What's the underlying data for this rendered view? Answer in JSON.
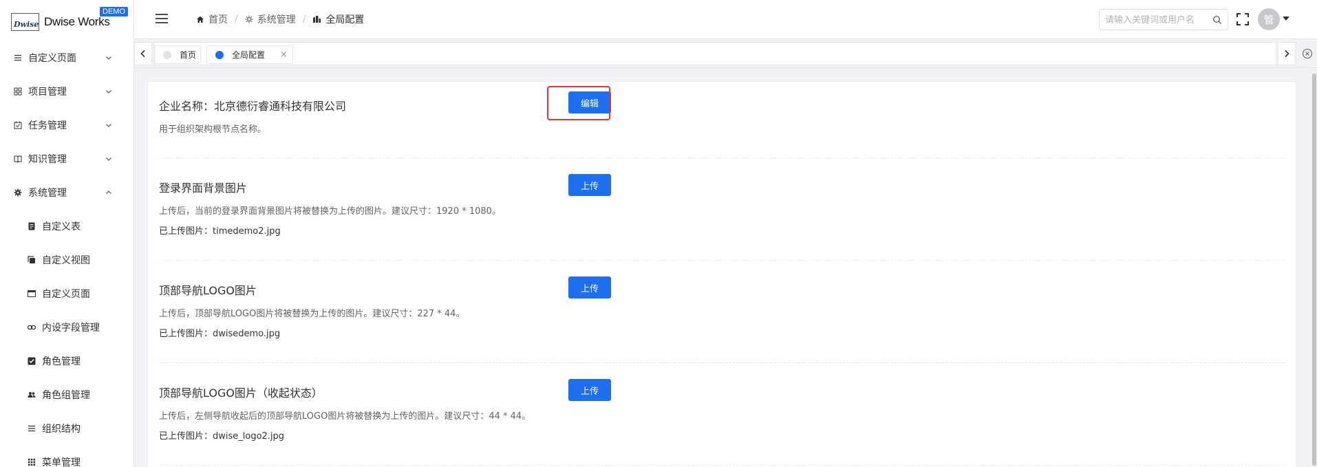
{
  "brand": {
    "logo_mark": "Dwise",
    "name": "Dwise Works",
    "badge": "DEMO",
    "accent": "#1e6ef0"
  },
  "sidebar": {
    "items": [
      {
        "label": "自定义页面",
        "icon": "list-icon"
      },
      {
        "label": "项目管理",
        "icon": "grid-icon"
      },
      {
        "label": "任务管理",
        "icon": "calendar-check-icon"
      },
      {
        "label": "知识管理",
        "icon": "book-icon"
      },
      {
        "label": "系统管理",
        "icon": "gear-icon",
        "expanded": true
      }
    ],
    "sub_items": [
      {
        "label": "自定义表",
        "icon": "document-icon"
      },
      {
        "label": "自定义视图",
        "icon": "copy-icon"
      },
      {
        "label": "自定义页面",
        "icon": "window-icon"
      },
      {
        "label": "内设字段管理",
        "icon": "link-icon"
      },
      {
        "label": "角色管理",
        "icon": "checkbox-icon"
      },
      {
        "label": "角色组管理",
        "icon": "group-icon"
      },
      {
        "label": "组织结构",
        "icon": "list-icon"
      },
      {
        "label": "菜单管理",
        "icon": "dots-grid-icon"
      }
    ]
  },
  "header": {
    "breadcrumb": [
      {
        "label": "首页",
        "icon": "home-icon"
      },
      {
        "label": "系统管理",
        "icon": "gear-icon"
      },
      {
        "label": "全局配置",
        "icon": "building-icon"
      }
    ],
    "search_placeholder": "请输入关键词或用户名",
    "avatar_text": "管"
  },
  "tabs": [
    {
      "label": "首页",
      "active": false,
      "dot_color": "#e4e4e4"
    },
    {
      "label": "全局配置",
      "active": true,
      "dot_color": "#1e6ef0",
      "close": "×"
    }
  ],
  "settings": [
    {
      "title": "企业名称：北京德衍睿通科技有限公司",
      "button": "编辑",
      "desc": "用于组织架构根节点名称。",
      "file": ""
    },
    {
      "title": "登录界面背景图片",
      "button": "上传",
      "desc": "上传后，当前的登录界面背景图片将被替换为上传的图片。建议尺寸：1920 * 1080。",
      "file": "已上传图片：timedemo2.jpg"
    },
    {
      "title": "顶部导航LOGO图片",
      "button": "上传",
      "desc": "上传后，顶部导航LOGO图片将被替换为上传的图片。建议尺寸：227 * 44。",
      "file": "已上传图片：dwisedemo.jpg"
    },
    {
      "title": "顶部导航LOGO图片（收起状态）",
      "button": "上传",
      "desc": "上传后，左侧导航收起后的顶部导航LOGO图片将被替换为上传的图片。建议尺寸：44 * 44。",
      "file": "已上传图片：dwise_logo2.jpg"
    }
  ]
}
